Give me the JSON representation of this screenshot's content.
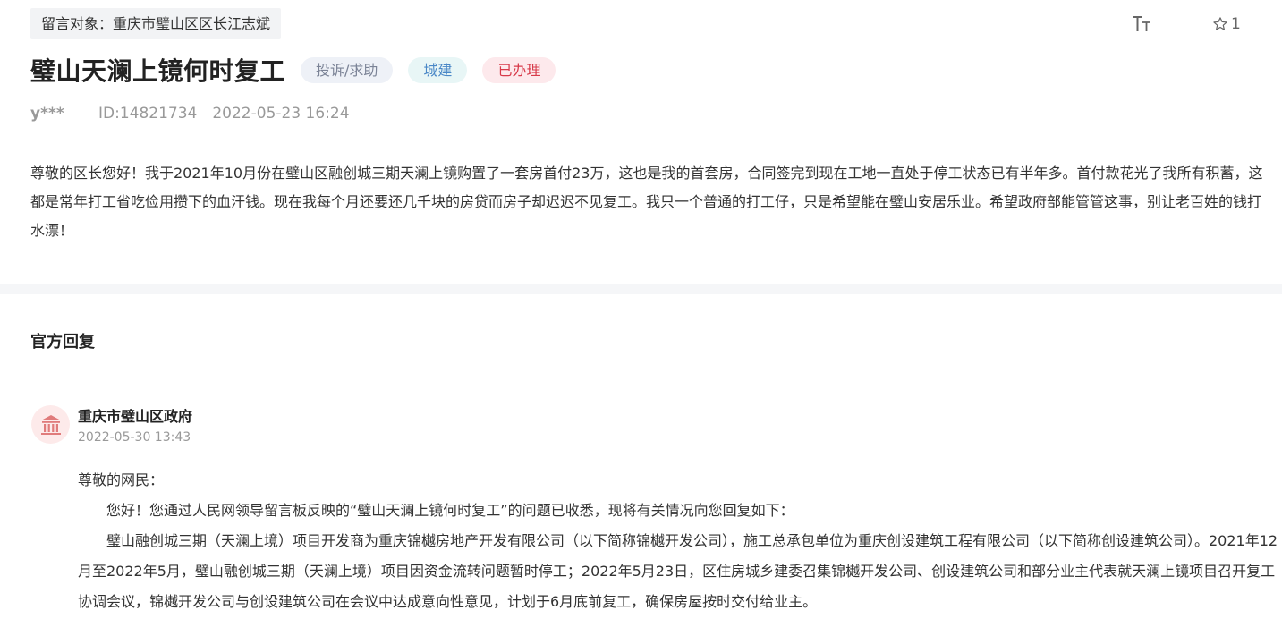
{
  "header": {
    "target_label": "留言对象：重庆市璧山区区长江志斌",
    "font_tool_icon": "font-size-icon",
    "star_icon": "star-outline-icon",
    "star_count": "1"
  },
  "post": {
    "title": "璧山天澜上镜何时复工",
    "tags": [
      {
        "label": "投诉/求助",
        "color": "#7b8396"
      },
      {
        "label": "城建",
        "color": "#4a88c7"
      },
      {
        "label": "已办理",
        "color": "#d83a4a"
      }
    ],
    "author": "y***",
    "id": "ID:14821734",
    "time": "2022-05-23 16:24",
    "content": "尊敬的区长您好！我于2021年10月份在璧山区融创城三期天澜上镜购置了一套房首付23万，这也是我的首套房，合同签完到现在工地一直处于停工状态已有半年多。首付款花光了我所有积蓄，这都是常年打工省吃俭用攒下的血汗钱。现在我每个月还要还几千块的房贷而房子却迟迟不见复工。我只一个普通的打工仔，只是希望能在璧山安居乐业。希望政府部能管管这事，别让老百姓的钱打水漂！"
  },
  "reply": {
    "heading": "官方回复",
    "avatar_icon": "government-building-icon",
    "org": "重庆市璧山区政府",
    "time": "2022-05-30 13:43",
    "greeting": "尊敬的网民：",
    "paragraphs": [
      "您好！您通过人民网领导留言板反映的“璧山天澜上镜何时复工”的问题已收悉，现将有关情况向您回复如下：",
      "璧山融创城三期（天澜上境）项目开发商为重庆锦樾房地产开发有限公司（以下简称锦樾开发公司），施工总承包单位为重庆创设建筑工程有限公司（以下简称创设建筑公司）。2021年12月至2022年5月，璧山融创城三期（天澜上境）项目因资金流转问题暂时停工；2022年5月23日，区住房城乡建委召集锦樾开发公司、创设建筑公司和部分业主代表就天澜上镜项目召开复工协调会议，锦樾开发公司与创设建筑公司在会议中达成意向性意见，计划于6月底前复工，确保房屋按时交付给业主。"
    ]
  },
  "colors": {
    "accent_red": "#d83a4a",
    "accent_blue": "#4a88c7",
    "muted": "#999999"
  }
}
